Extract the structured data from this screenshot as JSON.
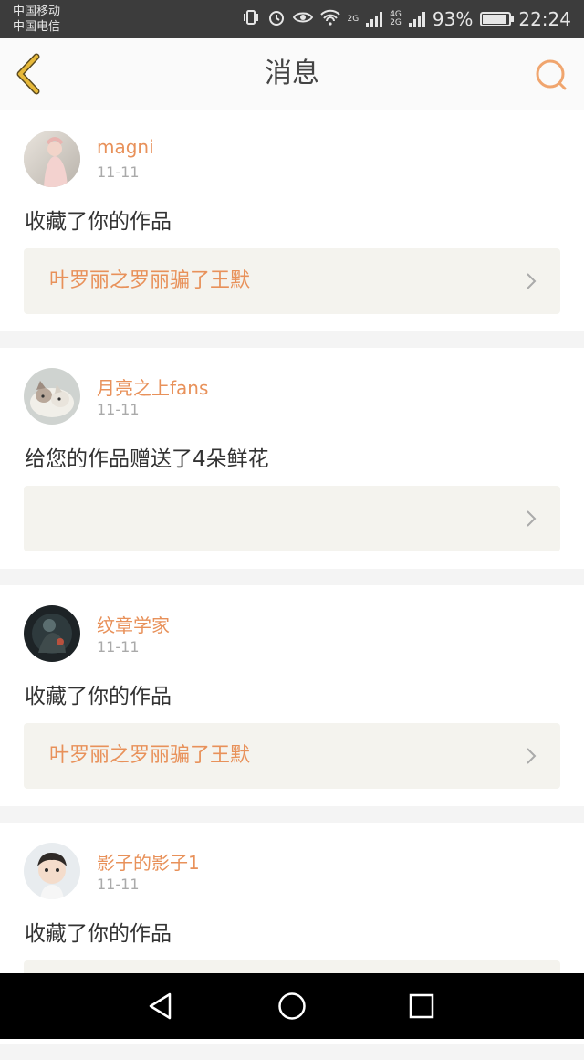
{
  "status_bar": {
    "carrier_1": "中国移动",
    "carrier_2": "中国电信",
    "battery": "93%",
    "battery_level": 0.93,
    "time": "22:24",
    "net_1": "2G",
    "net_2a": "4G",
    "net_2b": "2G",
    "icons": [
      "vibrate-icon",
      "alarm-icon",
      "eye-icon",
      "wifi-icon",
      "signal-icon",
      "battery-icon"
    ]
  },
  "header": {
    "title": "消息",
    "back_icon": "chevron-left-icon",
    "search_icon": "search-icon"
  },
  "messages": [
    {
      "user": "magni",
      "date": "11-11",
      "action": "收藏了你的作品",
      "work": "叶罗丽之罗丽骗了王默",
      "avatar": "avatar-photo-girl"
    },
    {
      "user": "月亮之上fans",
      "date": "11-11",
      "action": "给您的作品赠送了4朵鲜花",
      "work": "",
      "avatar": "avatar-photo-cat"
    },
    {
      "user": "纹章学家",
      "date": "11-11",
      "action": "收藏了你的作品",
      "work": "叶罗丽之罗丽骗了王默",
      "avatar": "avatar-photo-dark"
    },
    {
      "user": "影子的影子1",
      "date": "11-11",
      "action": "收藏了你的作品",
      "work": "",
      "avatar": "avatar-photo-child"
    }
  ],
  "colors": {
    "accent": "#e8915a",
    "back_icon": "#d9a52a",
    "card_link_bg": "#f4f3ee"
  },
  "nav": {
    "icons": [
      "back-triangle-icon",
      "home-circle-icon",
      "recents-square-icon"
    ]
  }
}
